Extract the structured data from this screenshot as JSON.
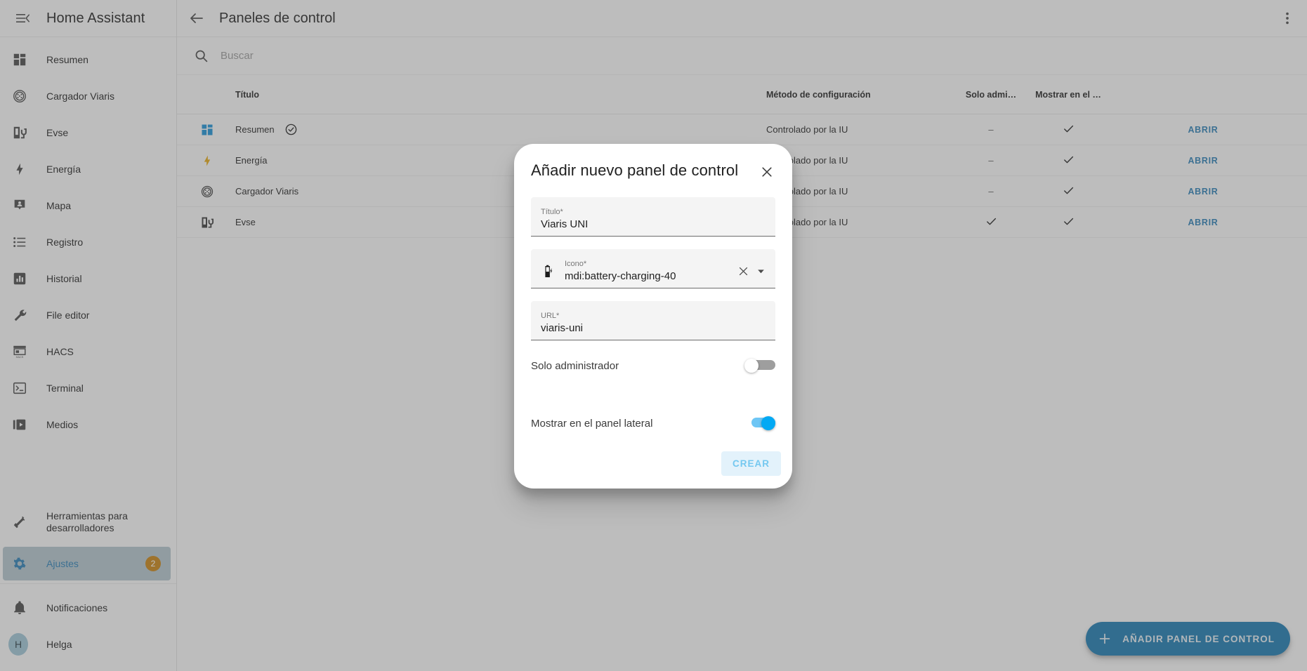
{
  "sidebar": {
    "title": "Home Assistant",
    "menu_icon": "menu-collapse-icon",
    "items": [
      {
        "label": "Resumen",
        "icon": "view-dashboard-icon"
      },
      {
        "label": "Cargador Viaris",
        "icon": "ev-plug-type2-icon"
      },
      {
        "label": "Evse",
        "icon": "ev-station-icon"
      },
      {
        "label": "Energía",
        "icon": "lightning-bolt-icon"
      },
      {
        "label": "Mapa",
        "icon": "map-marker-account-icon"
      },
      {
        "label": "Registro",
        "icon": "format-list-bulleted-icon"
      },
      {
        "label": "Historial",
        "icon": "chart-box-icon"
      },
      {
        "label": "File editor",
        "icon": "wrench-icon"
      },
      {
        "label": "HACS",
        "icon": "hacs-icon"
      },
      {
        "label": "Terminal",
        "icon": "console-icon"
      },
      {
        "label": "Medios",
        "icon": "play-box-multiple-icon"
      }
    ],
    "dev_tools": {
      "label": "Herramientas para desarrolladores",
      "icon": "hammer-icon"
    },
    "settings": {
      "label": "Ajustes",
      "icon": "cog-icon",
      "badge": "2"
    },
    "notifications": {
      "label": "Notificaciones",
      "icon": "bell-icon"
    },
    "user": {
      "label": "Helga",
      "initial": "H"
    }
  },
  "toolbar": {
    "back_icon": "arrow-left-icon",
    "title": "Paneles de control",
    "overflow_icon": "dots-vertical-icon"
  },
  "search": {
    "icon": "search-icon",
    "placeholder": "Buscar",
    "value": ""
  },
  "table": {
    "headers": {
      "title": "Título",
      "method": "Método de configuración",
      "admin": "Solo admi…",
      "show": "Mostrar en el …",
      "action": ""
    },
    "rows": [
      {
        "icon": "view-dashboard-icon",
        "title": "Resumen",
        "default_badge": "check-circle-outline-icon",
        "method": "Controlado por la IU",
        "admin": "–",
        "show": "check-icon",
        "action": "ABRIR"
      },
      {
        "icon": "lightning-bolt-icon",
        "title": "Energía",
        "default_badge": "",
        "method": "Controlado por la IU",
        "admin": "–",
        "show": "check-icon",
        "action": "ABRIR"
      },
      {
        "icon": "ev-plug-type2-icon",
        "title": "Cargador Viaris",
        "default_badge": "",
        "method": "Controlado por la IU",
        "admin": "–",
        "show": "check-icon",
        "action": "ABRIR"
      },
      {
        "icon": "ev-station-icon",
        "title": "Evse",
        "default_badge": "",
        "method": "Controlado por la IU",
        "admin": "check-icon",
        "show": "check-icon",
        "action": "ABRIR"
      }
    ]
  },
  "fab": {
    "icon": "plus-icon",
    "label": "AÑADIR PANEL DE CONTROL"
  },
  "dialog": {
    "title": "Añadir nuevo panel de control",
    "close_icon": "close-icon",
    "fields": {
      "titulo": {
        "label": "Título*",
        "value": "Viaris UNI"
      },
      "icono": {
        "label": "Icono*",
        "value": "mdi:battery-charging-40",
        "leading_icon": "battery-charging-40-icon",
        "clear_icon": "close-icon",
        "dropdown_icon": "menu-down-icon"
      },
      "url": {
        "label": "URL*",
        "value": "viaris-uni"
      }
    },
    "toggles": [
      {
        "label": "Solo administrador",
        "state": "off"
      },
      {
        "label": "Mostrar en el panel lateral",
        "state": "on"
      }
    ],
    "primary_button": "CREAR"
  },
  "colors": {
    "accent": "#2b7fb5",
    "fab_bg": "#1b7ab0",
    "badge": "#c98413",
    "switch_on": "#03a9f4",
    "active_item_bg": "#b3c5ce"
  }
}
